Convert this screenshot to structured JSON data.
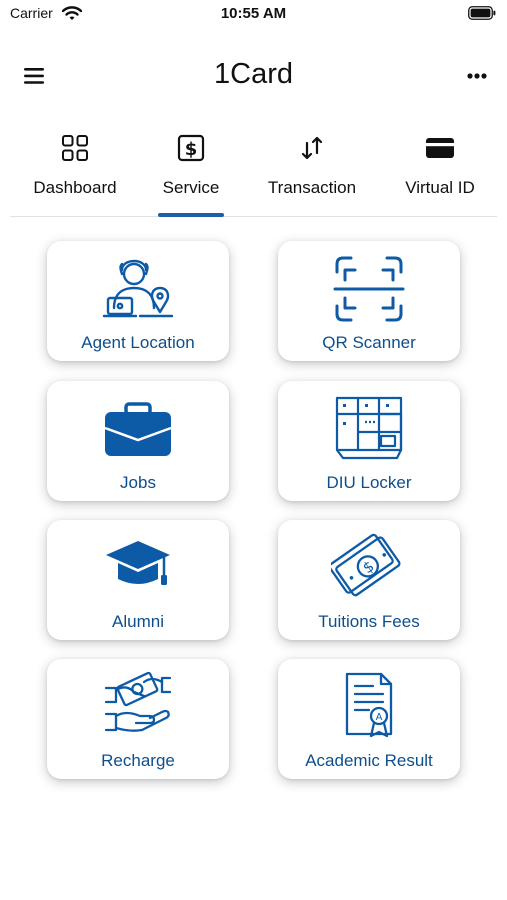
{
  "status_bar": {
    "carrier": "Carrier",
    "time": "10:55 AM"
  },
  "header": {
    "title": "1Card"
  },
  "tabs": [
    {
      "label": "Dashboard",
      "icon": "grid-icon",
      "active": false
    },
    {
      "label": "Service",
      "icon": "dollar-icon",
      "active": true
    },
    {
      "label": "Transaction",
      "icon": "transfer-arrows-icon",
      "active": false
    },
    {
      "label": "Virtual ID",
      "icon": "card-icon",
      "active": false
    }
  ],
  "services": [
    {
      "label": "Agent Location",
      "icon": "agent-location-icon"
    },
    {
      "label": "QR Scanner",
      "icon": "qr-scan-icon"
    },
    {
      "label": "Jobs",
      "icon": "briefcase-icon"
    },
    {
      "label": "DIU Locker",
      "icon": "locker-icon"
    },
    {
      "label": "Alumni",
      "icon": "graduation-cap-icon"
    },
    {
      "label": "Tuitions Fees",
      "icon": "money-icon"
    },
    {
      "label": "Recharge",
      "icon": "recharge-hands-icon"
    },
    {
      "label": "Academic Result",
      "icon": "certificate-icon"
    }
  ],
  "colors": {
    "accent": "#1f5ea8",
    "icon_blue": "#0d5aa7",
    "label_blue": "#0d4f8c"
  }
}
